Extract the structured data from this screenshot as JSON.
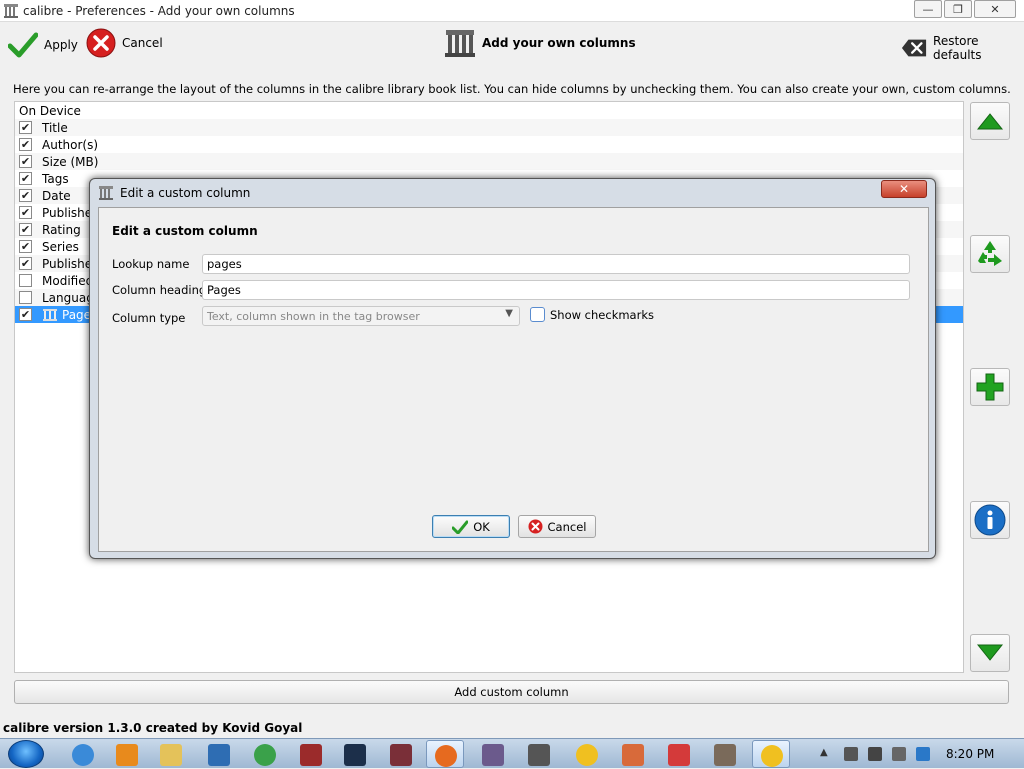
{
  "window": {
    "title": "calibre - Preferences - Add your own columns",
    "minimize": "—",
    "restore": "❐",
    "close": "✕"
  },
  "toolbar": {
    "apply_label": "Apply",
    "cancel_label": "Cancel",
    "center_title": "Add your own columns",
    "restore_label": "Restore defaults"
  },
  "description": "Here you can re-arrange the layout of the columns in the calibre library book list. You can hide columns by unchecking them. You can also create your own, custom columns.",
  "columns_list": {
    "items": [
      {
        "label": "On Device",
        "checked": null
      },
      {
        "label": "Title",
        "checked": true
      },
      {
        "label": "Author(s)",
        "checked": true
      },
      {
        "label": "Size (MB)",
        "checked": true
      },
      {
        "label": "Tags",
        "checked": true
      },
      {
        "label": "Date",
        "checked": true
      },
      {
        "label": "Published",
        "checked": true
      },
      {
        "label": "Rating",
        "checked": true
      },
      {
        "label": "Series",
        "checked": true
      },
      {
        "label": "Published",
        "checked": true
      },
      {
        "label": "Modified",
        "checked": false
      },
      {
        "label": "Languages",
        "checked": false
      },
      {
        "label": "Pages",
        "checked": true,
        "selected": true
      }
    ]
  },
  "add_custom_column_label": "Add custom column",
  "version_text": "calibre version 1.3.0 created by Kovid Goyal",
  "dialog": {
    "title": "Edit a custom column",
    "close": "✕",
    "heading": "Edit a custom column",
    "lookup_label": "Lookup name",
    "lookup_value": "pages",
    "heading_label": "Column heading",
    "heading_value": "Pages",
    "type_label": "Column type",
    "type_value": "Text, column shown in the tag browser",
    "show_checkmarks_label": "Show checkmarks",
    "ok_label": "OK",
    "cancel_label": "Cancel"
  },
  "taskbar": {
    "clock": "8:20 PM"
  },
  "colors": {
    "accent_green": "#2a9d2a",
    "cancel_red": "#d62020",
    "selection_blue": "#3399ff",
    "info_blue": "#1b6fc6"
  }
}
